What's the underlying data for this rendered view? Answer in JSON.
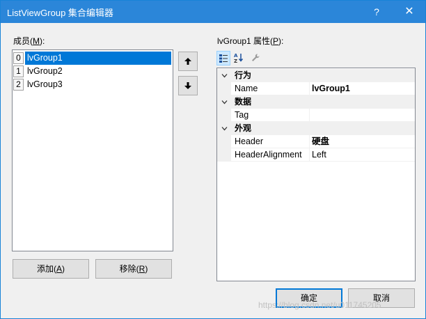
{
  "window": {
    "title": "ListViewGroup 集合编辑器",
    "help_glyph": "?",
    "close_glyph": "✕"
  },
  "members": {
    "label_prefix": "成员(",
    "label_key": "M",
    "label_suffix": "):",
    "items": [
      {
        "index": "0",
        "text": "lvGroup1",
        "selected": true
      },
      {
        "index": "1",
        "text": "lvGroup2",
        "selected": false
      },
      {
        "index": "2",
        "text": "lvGroup3",
        "selected": false
      }
    ],
    "move_up_glyph": "🡑",
    "move_down_glyph": "🡓",
    "add_prefix": "添加(",
    "add_key": "A",
    "add_suffix": ")",
    "remove_prefix": "移除(",
    "remove_key": "R",
    "remove_suffix": ")"
  },
  "properties": {
    "label_prefix": "lvGroup1 属性(",
    "label_key": "P",
    "label_suffix": "):",
    "toolbar": {
      "categorized_icon": "categorized-icon",
      "alphabetical_icon": "alphabetical-icon",
      "property_pages_icon": "wrench-icon"
    },
    "categories": [
      {
        "name": "行为",
        "properties": [
          {
            "name": "Name",
            "value": "lvGroup1",
            "bold": true
          }
        ]
      },
      {
        "name": "数据",
        "properties": [
          {
            "name": "Tag",
            "value": "",
            "bold": false
          }
        ]
      },
      {
        "name": "外观",
        "properties": [
          {
            "name": "Header",
            "value": "硬盘",
            "bold": true
          },
          {
            "name": "HeaderAlignment",
            "value": "Left",
            "bold": false
          }
        ]
      }
    ]
  },
  "footer": {
    "ok_label": "确定",
    "cancel_label": "取消"
  },
  "watermark": "https://blog.csdn.net/u011745205",
  "colors": {
    "titlebar": "#2b86d9",
    "selection": "#0078d7",
    "button_face": "#e1e1e1"
  }
}
